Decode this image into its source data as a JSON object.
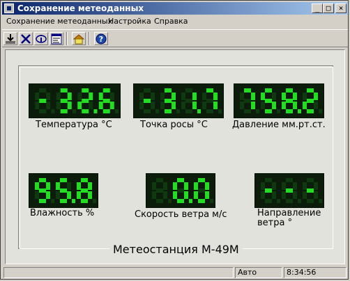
{
  "window": {
    "title": "Сохранение метеоданных",
    "minimize_glyph": "_",
    "maximize_glyph": "□",
    "close_glyph": "×"
  },
  "menu": {
    "items": [
      "Сохранение метеоданных",
      "Настройка",
      "Справка"
    ]
  },
  "toolbar": {
    "icons": [
      "download-icon",
      "delete-icon",
      "info-icon",
      "report-icon",
      "home-icon",
      "help-icon"
    ]
  },
  "display": {
    "station_title": "Метеостанция М-49М",
    "readouts": [
      {
        "value": "-32.6",
        "label": "Температура  °С"
      },
      {
        "value": "-31.7",
        "label": "Точка  росы  °С"
      },
      {
        "value": "758.2",
        "label": "Давление мм.рт.ст."
      },
      {
        "value": "95.8",
        "label": "Влажность %"
      },
      {
        "value": "0.0",
        "label": "Скорость ветра м/с"
      },
      {
        "value": "---",
        "label_line1": "Направление",
        "label_line2": "ветра °"
      }
    ],
    "colors": {
      "segment_on": "#22dd22",
      "segment_off": "#0f3a0f",
      "lcd_background": "#0b1c0b"
    }
  },
  "status": {
    "mode": "Авто",
    "time": "8:34:56"
  }
}
